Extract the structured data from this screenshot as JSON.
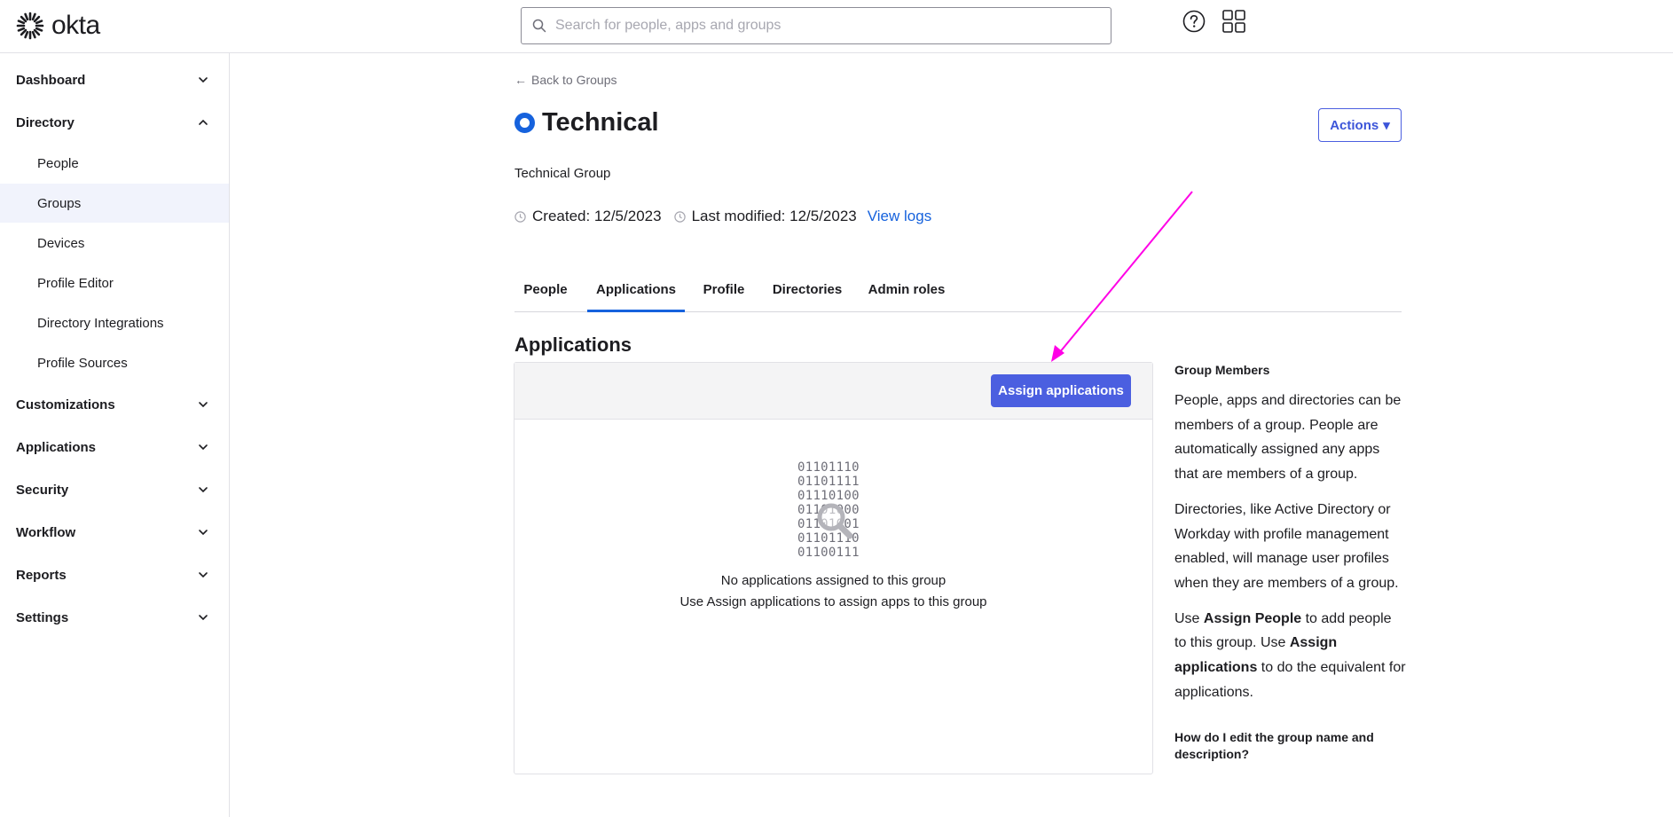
{
  "brand": {
    "name": "okta"
  },
  "search": {
    "placeholder": "Search for people, apps and groups"
  },
  "header_icons": [
    "help-icon",
    "app-grid-icon"
  ],
  "sidebar": {
    "sections": [
      {
        "label": "Dashboard",
        "expanded": false
      },
      {
        "label": "Directory",
        "expanded": true
      },
      {
        "label": "Customizations",
        "expanded": false
      },
      {
        "label": "Applications",
        "expanded": false
      },
      {
        "label": "Security",
        "expanded": false
      },
      {
        "label": "Workflow",
        "expanded": false
      },
      {
        "label": "Reports",
        "expanded": false
      },
      {
        "label": "Settings",
        "expanded": false
      }
    ],
    "directory_items": [
      {
        "label": "People"
      },
      {
        "label": "Groups",
        "active": true
      },
      {
        "label": "Devices"
      },
      {
        "label": "Profile Editor"
      },
      {
        "label": "Directory Integrations"
      },
      {
        "label": "Profile Sources"
      }
    ]
  },
  "page": {
    "back_link": "Back to Groups",
    "title": "Technical",
    "actions_label": "Actions",
    "description": "Technical Group",
    "created": "Created: 12/5/2023",
    "last_modified": "Last modified: 12/5/2023",
    "view_logs": "View logs"
  },
  "tabs": [
    {
      "label": "People"
    },
    {
      "label": "Applications",
      "active": true
    },
    {
      "label": "Profile"
    },
    {
      "label": "Directories"
    },
    {
      "label": "Admin roles"
    }
  ],
  "applications": {
    "heading": "Applications",
    "assign_button": "Assign applications",
    "binary_lines": [
      "01101110",
      "01101111",
      "01110100",
      "01101000",
      "01101001",
      "01101110",
      "01100111"
    ],
    "empty_title": "No applications assigned to this group",
    "empty_hint": "Use Assign applications to assign apps to this group"
  },
  "help": {
    "heading": "Group Members",
    "p1": "People, apps and directories can be members of a group. People are automatically assigned any apps that are members of a group.",
    "p2": "Directories, like Active Directory or Workday with profile management enabled, will manage user profiles when they are members of a group.",
    "p3": {
      "t1": "Use ",
      "b1": "Assign People",
      "t2": " to add people to this group. Use ",
      "b2": "Assign applications",
      "t3": " to do the equivalent for applications."
    },
    "heading2": "How do I edit the group name and description?"
  },
  "colors": {
    "accent": "#1662dd",
    "primary_button": "#4b5fe0",
    "active_nav_bg": "#f1f3fc",
    "annotation_arrow": "#ff00e6"
  }
}
